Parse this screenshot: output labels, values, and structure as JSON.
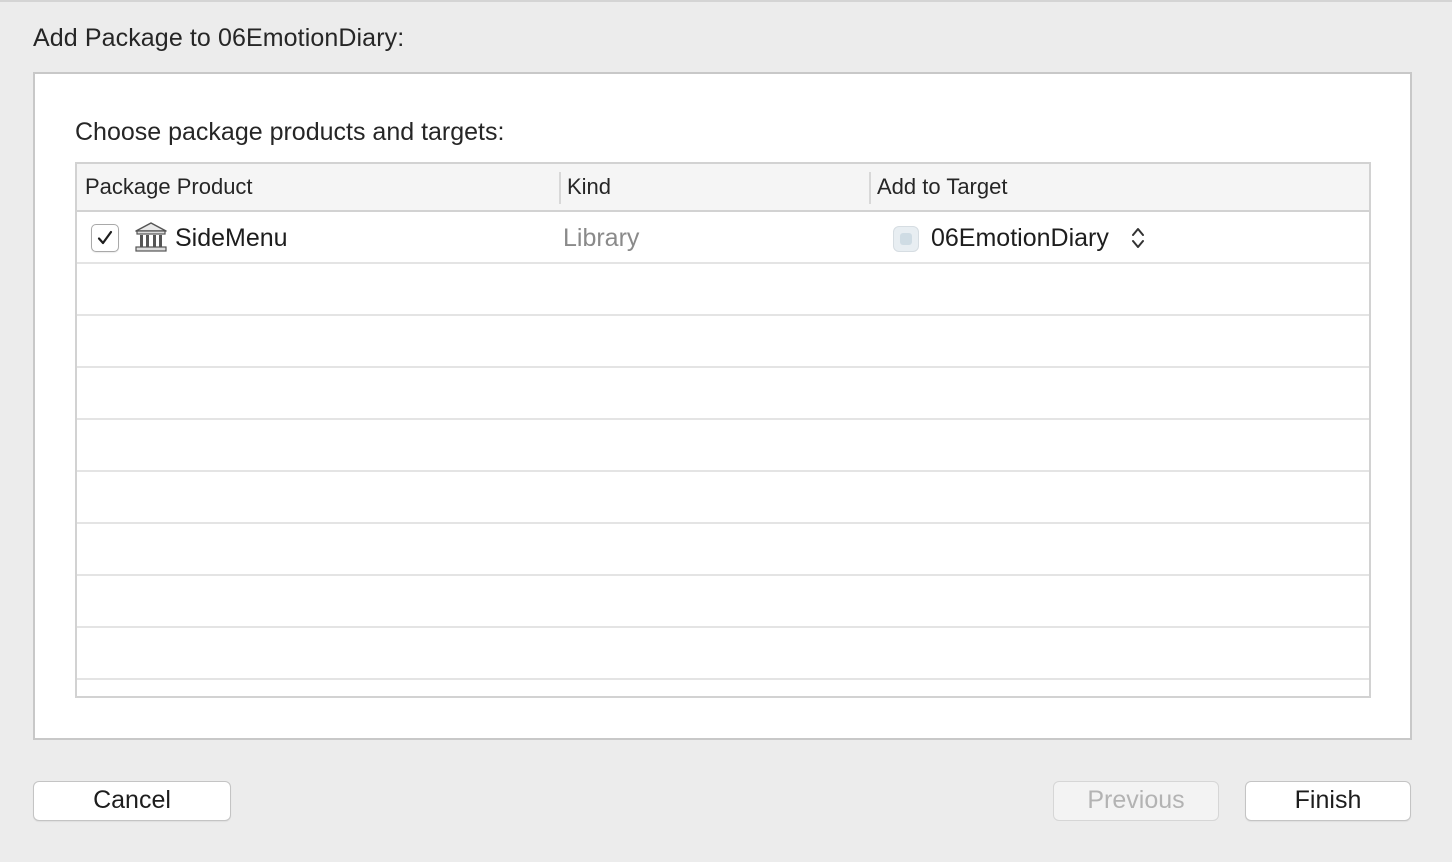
{
  "dialog": {
    "title": "Add Package to 06EmotionDiary:"
  },
  "panel": {
    "heading": "Choose package products and targets:"
  },
  "table": {
    "columns": [
      "Package Product",
      "Kind",
      "Add to Target"
    ],
    "rows": [
      {
        "checked": true,
        "product": "SideMenu",
        "product_icon": "library-icon",
        "kind": "Library",
        "target": "06EmotionDiary",
        "target_icon": "app-target-icon"
      }
    ]
  },
  "buttons": {
    "cancel": "Cancel",
    "previous": "Previous",
    "finish": "Finish"
  },
  "colors": {
    "background": "#ececec",
    "panel": "#ffffff",
    "disabled_text": "#b3b3b3",
    "secondary_text": "#8a8a8a"
  }
}
